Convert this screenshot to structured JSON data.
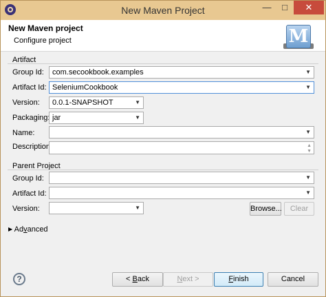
{
  "window": {
    "title": "New Maven Project",
    "minimize": "—",
    "maximize": "□",
    "close": "✕"
  },
  "header": {
    "title": "New Maven project",
    "subtitle": "Configure project",
    "logo_letter": "M"
  },
  "artifact": {
    "group_label": "Artifact",
    "group_id": {
      "label": "Group Id:",
      "value": "com.secookbook.examples"
    },
    "artifact_id": {
      "label": "Artifact Id:",
      "value": "SeleniumCookbook"
    },
    "version": {
      "label": "Version:",
      "value": "0.0.1-SNAPSHOT"
    },
    "packaging": {
      "label": "Packaging:",
      "value": "jar"
    },
    "name": {
      "label": "Name:",
      "value": ""
    },
    "description": {
      "label": "Description:",
      "value": ""
    }
  },
  "parent": {
    "group_label": "Parent Project",
    "group_id": {
      "label": "Group Id:",
      "value": ""
    },
    "artifact_id": {
      "label": "Artifact Id:",
      "value": ""
    },
    "version": {
      "label": "Version:",
      "value": ""
    },
    "browse": "Browse...",
    "clear": "Clear"
  },
  "advanced": {
    "prefix": "Ad",
    "mnemonic": "v",
    "suffix": "anced"
  },
  "footer": {
    "back": {
      "prefix": "< ",
      "mnemonic": "B",
      "suffix": "ack"
    },
    "next": {
      "mnemonic": "N",
      "suffix": "ext >"
    },
    "finish": {
      "mnemonic": "F",
      "suffix": "inish"
    },
    "cancel": "Cancel"
  }
}
